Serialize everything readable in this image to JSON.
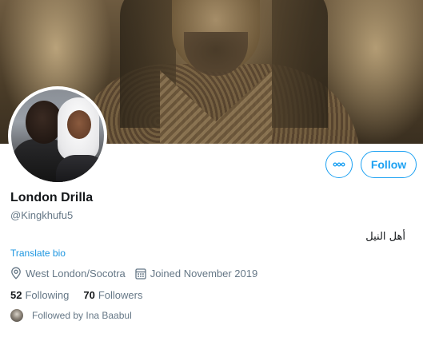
{
  "profile": {
    "display_name": "London Drilla",
    "handle": "@Kingkhufu5",
    "bio": "أهل النيل",
    "translate_label": "Translate bio",
    "location": "West London/Socotra",
    "joined": "Joined November 2019",
    "following_count": "52",
    "following_label": "Following",
    "followers_count": "70",
    "followers_label": "Followers",
    "followed_by": "Followed by Ina Baabul"
  },
  "actions": {
    "follow_label": "Follow",
    "more_icon": "more-horizontal-icon"
  },
  "icons": {
    "location": "location-pin-icon",
    "calendar": "calendar-icon"
  },
  "colors": {
    "accent": "#1da1f2",
    "link": "#1b95e0",
    "text_primary": "#14171a",
    "text_secondary": "#657786"
  }
}
